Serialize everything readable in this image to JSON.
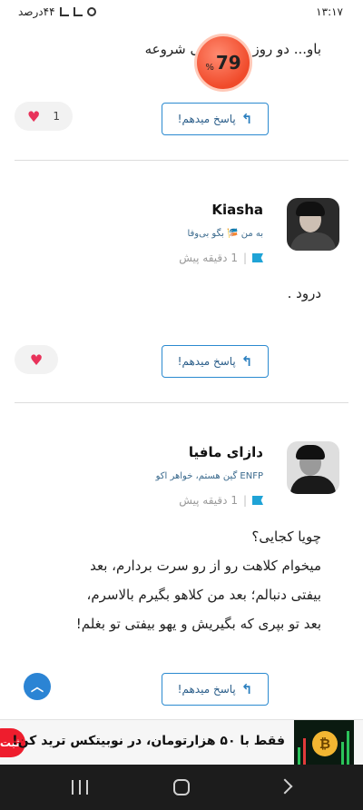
{
  "status_bar": {
    "time": "۱۳:۱۷",
    "battery": "۴۴درصد"
  },
  "score_badge": {
    "value": "79",
    "unit": "%"
  },
  "comments": [
    {
      "text_lines": [
        "باو... دو روز دیگه نهایی شروعه"
      ],
      "reply_label": "پاسخ میدهم!",
      "likes": "1"
    },
    {
      "username": "Kiasha",
      "bio": "به من 🎏 بگو بی‌وفا",
      "time_ago": "1 دقیقه پیش",
      "text_lines": [
        "درود ."
      ],
      "reply_label": "پاسخ میدهم!",
      "likes": ""
    },
    {
      "username": "دازای مافیا",
      "bio": "ENFP گین هستم، خواهر اکو",
      "time_ago": "1 دقیقه پیش",
      "text_lines": [
        "چویا کجایی؟",
        "میخوام کلاهت رو از رو سرت بردارم، بعد",
        "بیفتی دنبالم؛ بعد من کلاهو بگیرم بالاسرم،",
        "بعد تو بپری که بگیریش و یهو بیفتی تو بغلم!"
      ],
      "reply_label": "پاسخ میدهم!"
    }
  ],
  "ad": {
    "text": "فقط با ۵۰ هزارتومان، در نوبیتکس ترید کن!",
    "cta": "ثبت",
    "coin_symbol": "₿"
  },
  "colors": {
    "accent": "#2b8ad0",
    "heart": "#e8325a",
    "badge": "#f04a2a",
    "ad_cta": "#ee1d2d"
  },
  "icons": [
    "reply-icon",
    "heart-icon",
    "flag-icon",
    "chevron-up-icon",
    "recents-icon",
    "home-icon",
    "back-icon",
    "alarm-icon",
    "signal-icon"
  ]
}
